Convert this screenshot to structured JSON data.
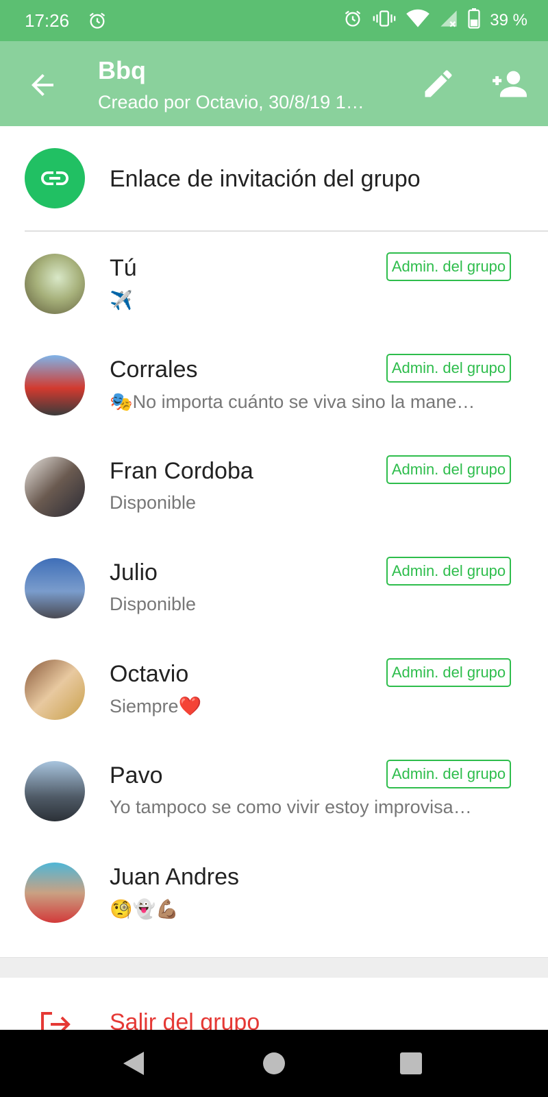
{
  "status_bar": {
    "time": "17:26",
    "battery": "39 %"
  },
  "header": {
    "title": "Bbq",
    "subtitle": "Creado por Octavio, 30/8/19 1…",
    "icons": {
      "back": "arrow-back-icon",
      "edit": "pencil-icon",
      "add": "add-person-icon"
    },
    "bg_color": "#8ad19c",
    "status_bg_color": "#5cbf72"
  },
  "invite": {
    "label": "Enlace de invitación del grupo",
    "icon": "link-icon",
    "color": "#21c063"
  },
  "members": [
    {
      "name": "Tú",
      "status": "✈️",
      "admin": "Admin. del grupo"
    },
    {
      "name": "Corrales",
      "status": "🎭No importa cuánto se viva sino la mane…",
      "admin": "Admin. del grupo"
    },
    {
      "name": "Fran Cordoba",
      "status": "Disponible",
      "admin": "Admin. del grupo"
    },
    {
      "name": "Julio",
      "status": "Disponible",
      "admin": "Admin. del grupo"
    },
    {
      "name": "Octavio",
      "status": "Siempre❤️",
      "admin": "Admin. del grupo"
    },
    {
      "name": "Pavo",
      "status": "Yo tampoco se como vivir estoy improvisa…",
      "admin": "Admin. del grupo"
    },
    {
      "name": "Juan Andres",
      "status": "🧐👻💪🏽",
      "admin": ""
    }
  ],
  "exit": {
    "label": "Salir del grupo",
    "icon": "exit-icon",
    "color": "#e53935"
  },
  "accent_color": "#2ebd4c"
}
